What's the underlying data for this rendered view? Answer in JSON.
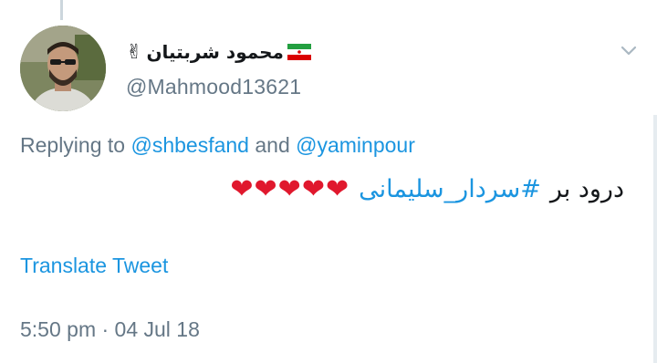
{
  "tweet": {
    "author": {
      "display_name": "محمود شربتیان",
      "emoji": "✌",
      "flag_icon": "iran-flag-icon",
      "handle": "@Mahmood13621"
    },
    "replying": {
      "prefix": "Replying to",
      "mention_1": "@shbesfand",
      "conjunction": "and",
      "mention_2": "@yaminpour"
    },
    "text": {
      "lead": "درود بر",
      "hashtag": "#سردار_سلیمانی",
      "hearts": "❤❤❤❤❤"
    },
    "translate_label": "Translate Tweet",
    "timestamp": "5:50 pm · 04 Jul 18"
  },
  "colors": {
    "link": "#1b95e0",
    "muted": "#657786",
    "text": "#14171a",
    "heart": "#e0182d"
  },
  "icons": {
    "menu": "chevron-down-icon"
  }
}
